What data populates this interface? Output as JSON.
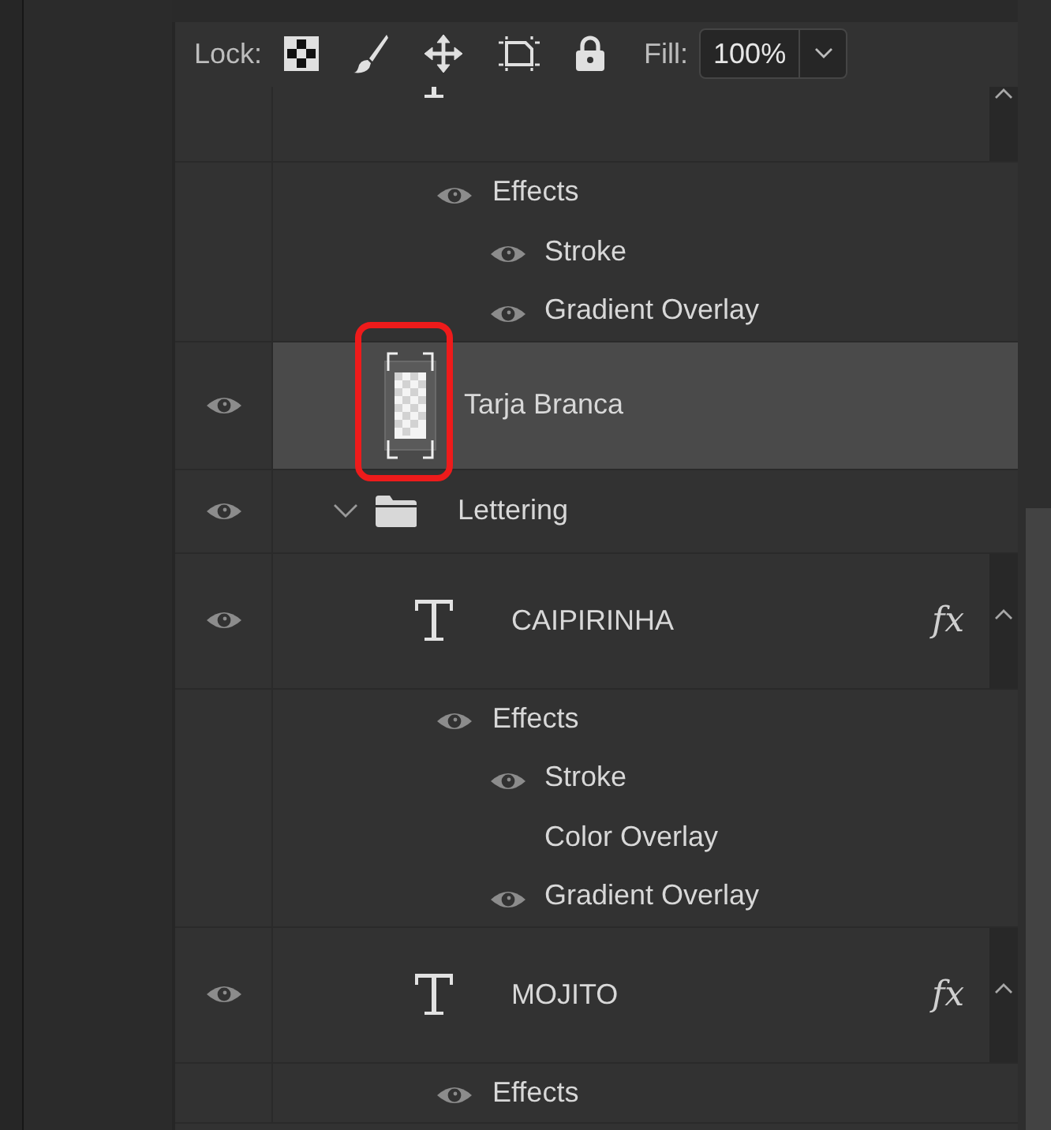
{
  "lock_bar": {
    "lock_label": "Lock:",
    "fill_label": "Fill:",
    "fill_value": "100%"
  },
  "layers": [
    {
      "kind": "text",
      "selected": false,
      "effects_expanded": true,
      "effects": [
        {
          "name": "Effects",
          "visible": true,
          "children": [
            {
              "name": "Stroke",
              "visible": true
            },
            {
              "name": "Gradient Overlay",
              "visible": true
            }
          ]
        }
      ]
    },
    {
      "kind": "image",
      "name": "Tarja Branca",
      "visible": true,
      "selected": true,
      "highlighted": true
    },
    {
      "kind": "group",
      "name": "Lettering",
      "visible": true,
      "selected": false,
      "expanded": true,
      "children": [
        {
          "kind": "text",
          "name": "CAIPIRINHA",
          "visible": true,
          "selected": false,
          "badge": "fx",
          "effects_expanded": true,
          "effects": [
            {
              "name": "Effects",
              "visible": true,
              "children": [
                {
                  "name": "Stroke",
                  "visible": true
                },
                {
                  "name": "Color Overlay",
                  "visible": false
                },
                {
                  "name": "Gradient Overlay",
                  "visible": true
                }
              ]
            }
          ]
        },
        {
          "kind": "text",
          "name": "MOJITO",
          "visible": true,
          "selected": false,
          "badge": "fx",
          "effects_expanded": true,
          "effects": [
            {
              "name": "Effects",
              "visible": true
            }
          ]
        }
      ]
    }
  ]
}
